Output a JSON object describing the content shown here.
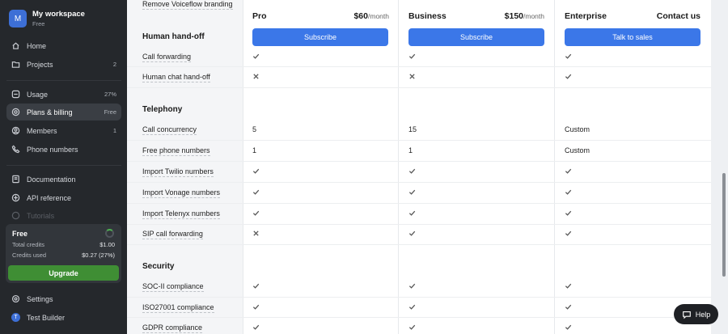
{
  "workspace": {
    "initial": "M",
    "name": "My workspace",
    "plan": "Free"
  },
  "nav": {
    "home": "Home",
    "projects": "Projects",
    "projects_count": "2",
    "usage": "Usage",
    "usage_meta": "27%",
    "plans": "Plans & billing",
    "plans_meta": "Free",
    "members": "Members",
    "members_count": "1",
    "phone": "Phone numbers",
    "docs": "Documentation",
    "api": "API reference",
    "tutorials": "Tutorials",
    "settings": "Settings",
    "user": "Test Builder",
    "user_initial": "T"
  },
  "credits": {
    "title": "Free",
    "total_label": "Total credits",
    "total_value": "$1.00",
    "used_label": "Credits used",
    "used_value": "$0.27 (27%)",
    "used_fraction": 0.27,
    "upgrade": "Upgrade"
  },
  "plans": [
    {
      "name": "Pro",
      "price": "$60",
      "per": "/month",
      "button": "Subscribe"
    },
    {
      "name": "Business",
      "price": "$150",
      "per": "/month",
      "button": "Subscribe"
    },
    {
      "name": "Enterprise",
      "price": "Contact us",
      "per": "",
      "button": "Talk to sales"
    }
  ],
  "top_feature": "Remove Voiceflow branding",
  "sections": {
    "handoff": "Human hand-off",
    "telephony": "Telephony",
    "security": "Security"
  },
  "features": {
    "call_forwarding": {
      "label": "Call forwarding",
      "values": [
        "check",
        "check",
        "check"
      ]
    },
    "human_chat": {
      "label": "Human chat hand-off",
      "values": [
        "cross",
        "cross",
        "check"
      ]
    },
    "concurrency": {
      "label": "Call concurrency",
      "values": [
        "5",
        "15",
        "Custom"
      ]
    },
    "free_phone": {
      "label": "Free phone numbers",
      "values": [
        "1",
        "1",
        "Custom"
      ]
    },
    "twilio": {
      "label": "Import Twilio numbers",
      "values": [
        "check",
        "check",
        "check"
      ]
    },
    "vonage": {
      "label": "Import Vonage numbers",
      "values": [
        "check",
        "check",
        "check"
      ]
    },
    "telenyx": {
      "label": "Import Telenyx numbers",
      "values": [
        "check",
        "check",
        "check"
      ]
    },
    "sip": {
      "label": "SIP call forwarding",
      "values": [
        "cross",
        "check",
        "check"
      ]
    },
    "soc2": {
      "label": "SOC-II compliance",
      "values": [
        "check",
        "check",
        "check"
      ]
    },
    "iso": {
      "label": "ISO27001 compliance",
      "values": [
        "check",
        "check",
        "check"
      ]
    },
    "gdpr": {
      "label": "GDPR compliance",
      "values": [
        "check",
        "check",
        "check"
      ]
    }
  },
  "help": "Help"
}
